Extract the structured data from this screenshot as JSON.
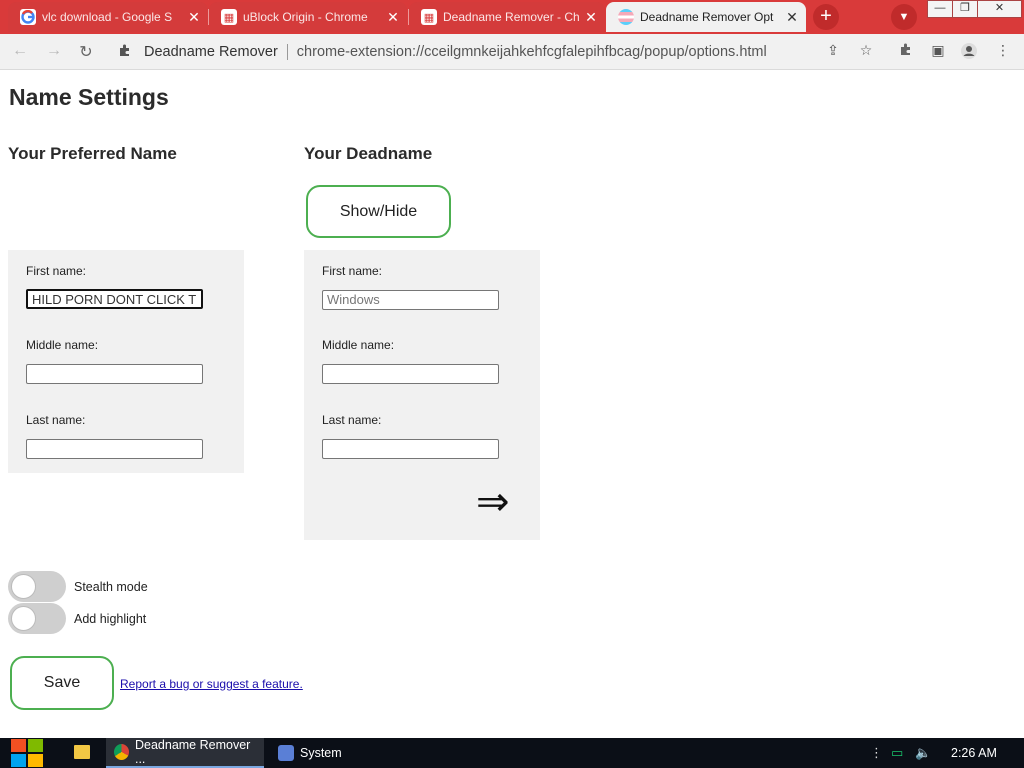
{
  "browser": {
    "tabs": [
      {
        "title": "vlc download - Google S",
        "favicon": "google-icon",
        "active": false
      },
      {
        "title": "uBlock Origin - Chrome",
        "favicon": "webstore-icon",
        "active": false
      },
      {
        "title": "Deadname Remover - Ch",
        "favicon": "webstore-icon",
        "active": false
      },
      {
        "title": "Deadname Remover Opt",
        "favicon": "trans-flag-icon",
        "active": true
      }
    ],
    "new_tab_label": "+",
    "site_name": "Deadname Remover",
    "url": "chrome-extension://cceilgmnkeijahkehfcgfalepihfbcag/popup/options.html",
    "accent_color": "#d93a3a"
  },
  "page": {
    "title": "Name Settings",
    "preferred": {
      "heading": "Your Preferred Name",
      "first_label": "First name:",
      "first_value": "HILD PORN DONT CLICK T",
      "middle_label": "Middle name:",
      "middle_value": "",
      "last_label": "Last name:",
      "last_value": ""
    },
    "deadname": {
      "heading": "Your Deadname",
      "show_hide_label": "Show/Hide",
      "first_label": "First name:",
      "first_value": "Windows",
      "middle_label": "Middle name:",
      "middle_value": "",
      "last_label": "Last name:",
      "last_value": "",
      "arrow": "⇒"
    },
    "toggles": [
      {
        "label": "Stealth mode",
        "on": false
      },
      {
        "label": "Add highlight",
        "on": false
      }
    ],
    "save_label": "Save",
    "report_link": "Report a bug or suggest a feature.",
    "button_border_color": "#4caf50"
  },
  "taskbar": {
    "items": [
      {
        "label": "Deadname Remover ...",
        "icon": "chrome-icon",
        "active": true
      },
      {
        "label": "System",
        "icon": "system-icon",
        "active": false
      }
    ],
    "time": "2:26 AM"
  }
}
